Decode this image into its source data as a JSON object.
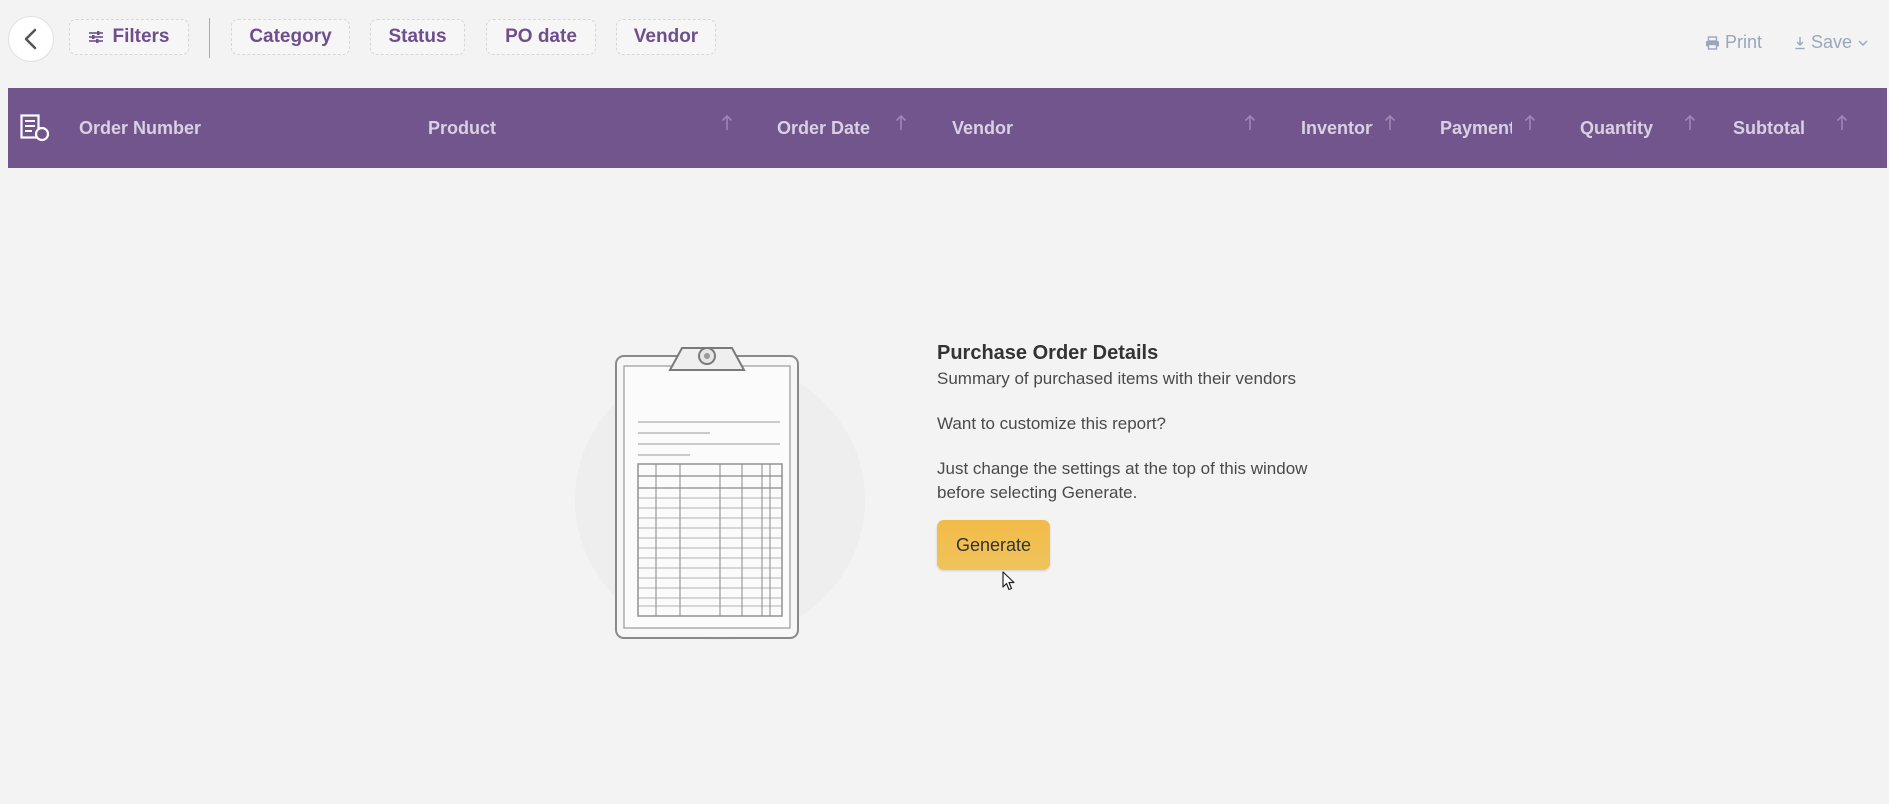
{
  "toolbar": {
    "filters_label": "Filters",
    "chips": [
      "Category",
      "Status",
      "PO date",
      "Vendor"
    ],
    "print_label": "Print",
    "save_label": "Save"
  },
  "table": {
    "columns": [
      "Order Number",
      "Product",
      "Order Date",
      "Vendor",
      "Inventory",
      "Payment",
      "Quantity",
      "Subtotal"
    ]
  },
  "empty_state": {
    "title": "Purchase Order Details",
    "subtitle": "Summary of purchased items with their vendors",
    "question": "Want to customize this report?",
    "description": "Just change the settings at the top of this window before selecting Generate.",
    "button_label": "Generate"
  },
  "colors": {
    "header_bg": "#73558e",
    "chip_text": "#6f4e8e",
    "generate_bg": "#f2bb48",
    "page_bg": "#f3f3f3"
  },
  "icons": [
    "back-arrow-icon",
    "filter-sliders-icon",
    "printer-icon",
    "download-icon",
    "chevron-down-icon",
    "report-checklist-icon",
    "sort-arrow-up-icon",
    "clipboard-illustration",
    "mouse-pointer-icon"
  ]
}
